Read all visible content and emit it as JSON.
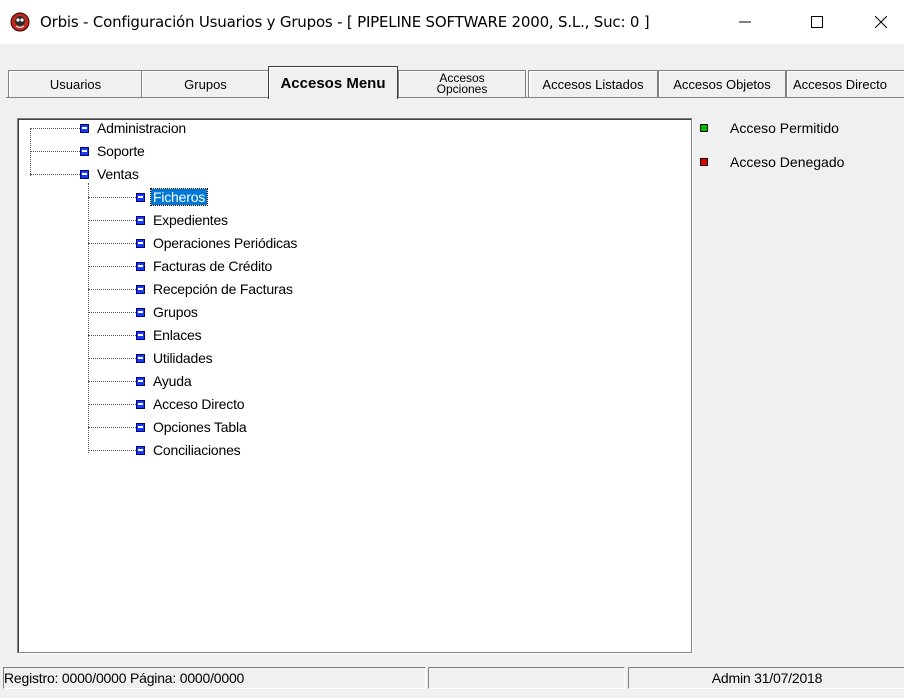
{
  "window": {
    "title": "Orbis - Configuración Usuarios y Grupos - [ PIPELINE SOFTWARE 2000, S.L.,  Suc: 0 ]",
    "minimize_glyph": "—",
    "maximize_glyph": "☐",
    "close_glyph": "✕",
    "icon": "orbis-app-icon"
  },
  "tabs": [
    {
      "label": "Usuarios"
    },
    {
      "label": "Grupos"
    },
    {
      "label": "Accesos Menu"
    },
    {
      "label_line1": "Accesos",
      "label_line2": "Opciones"
    },
    {
      "label": "Accesos Listados"
    },
    {
      "label": "Accesos Objetos"
    },
    {
      "label": "Accesos Directo"
    }
  ],
  "active_tab": "Accesos Menu",
  "tree": {
    "root_items": [
      {
        "label": "Administracion"
      },
      {
        "label": "Soporte"
      },
      {
        "label": "Ventas"
      }
    ],
    "ventas_children": [
      {
        "label": "Ficheros",
        "selected": true
      },
      {
        "label": "Expedientes"
      },
      {
        "label": "Operaciones Periódicas"
      },
      {
        "label": "Facturas de Crédito"
      },
      {
        "label": "Recepción de Facturas"
      },
      {
        "label": "Grupos"
      },
      {
        "label": "Enlaces"
      },
      {
        "label": "Utilidades"
      },
      {
        "label": "Ayuda"
      },
      {
        "label": "Acceso Directo"
      },
      {
        "label": "Opciones Tabla"
      },
      {
        "label": "Conciliaciones"
      }
    ]
  },
  "legend": {
    "allowed": {
      "label": "Acceso Permitido",
      "color": "#00c000"
    },
    "denied": {
      "label": "Acceso Denegado",
      "color": "#e00000"
    }
  },
  "statusbar": {
    "records": "Registro: 0000/0000  Página: 0000/0000",
    "empty1": "",
    "empty2": "",
    "user_date": "Admin 31/07/2018"
  }
}
